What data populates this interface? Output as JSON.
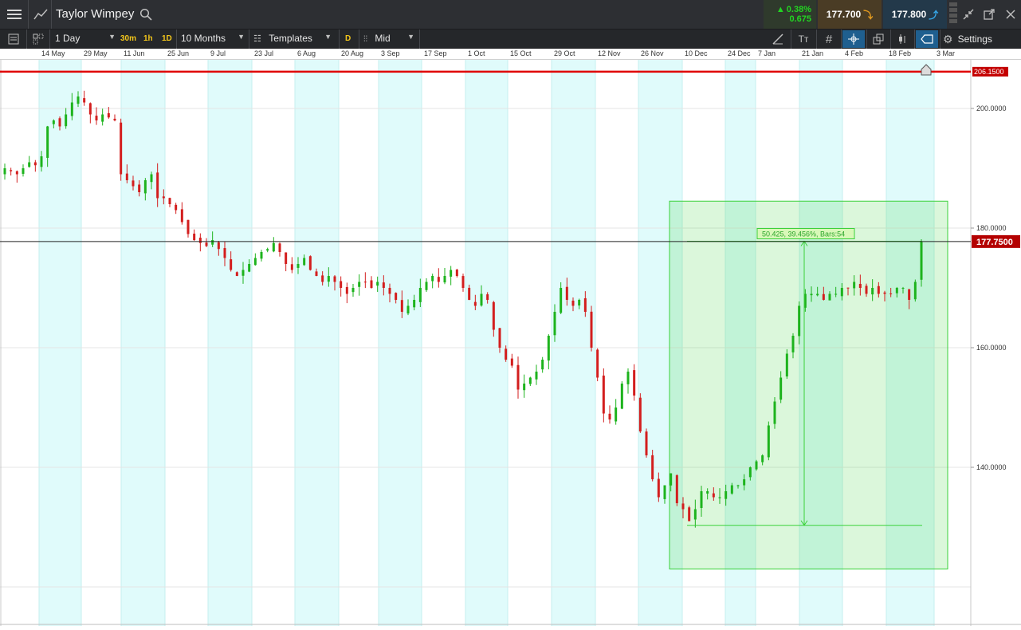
{
  "header": {
    "instrument": "Taylor Wimpey",
    "change_pct": "0.38%",
    "change_abs": "0.675",
    "sell_price": "177.700",
    "buy_price": "177.800"
  },
  "toolbar": {
    "interval": "1 Day",
    "quick_30m": "30m",
    "quick_1h": "1h",
    "quick_1d": "1D",
    "range": "10 Months",
    "templates": "Templates",
    "d_badge": "D",
    "price_type": "Mid",
    "text_tool": "Tт",
    "settings": "Settings"
  },
  "colors": {
    "up": "#1db31d",
    "down": "#d31e1e",
    "band": "#e0fbfb",
    "hline": "#e00000",
    "measure": "#3ad13a"
  },
  "chart_data": {
    "type": "candlestick",
    "date_labels": [
      "14 May",
      "29 May",
      "11 Jun",
      "25 Jun",
      "9 Jul",
      "23 Jul",
      "6 Aug",
      "20 Aug",
      "3 Sep",
      "17 Sep",
      "1 Oct",
      "15 Oct",
      "29 Oct",
      "12 Nov",
      "26 Nov",
      "10 Dec",
      "24 Dec",
      "7 Jan",
      "21 Jan",
      "4 Feb",
      "18 Feb",
      "3 Mar"
    ],
    "y_ticks": [
      "200.0000",
      "180.0000",
      "160.0000",
      "140.0000"
    ],
    "ylim": [
      117,
      216
    ],
    "horizontal_line": {
      "value": 206.15,
      "label": "206.1500"
    },
    "current_price": {
      "value": 177.75,
      "label": "177.7500"
    },
    "measurement": {
      "label": "50.425, 39.456%, Bars:54",
      "low": 130.3,
      "high": 177.8
    },
    "close_series": [
      190,
      189.5,
      189,
      190,
      191,
      190.5,
      192,
      197,
      198,
      197,
      199,
      201,
      202,
      201,
      199,
      198,
      199,
      198.5,
      198,
      189,
      188,
      187,
      186,
      188,
      189,
      185,
      185,
      184,
      183,
      181,
      179,
      178,
      177.5,
      177,
      178,
      176.5,
      175,
      173,
      172,
      173,
      174,
      175,
      176,
      176.5,
      177.5,
      176,
      174,
      173,
      174,
      175,
      173,
      172,
      171,
      172,
      171,
      170,
      169,
      170,
      171,
      171,
      170,
      171,
      170,
      169,
      168,
      166,
      167,
      168,
      170,
      171,
      172,
      171,
      172,
      173,
      172,
      170,
      168,
      167,
      169,
      168,
      163,
      160,
      158,
      157,
      153,
      154,
      155,
      156,
      158,
      162,
      166,
      170,
      168,
      167,
      168,
      166,
      160,
      155,
      149,
      148,
      150,
      154,
      156,
      152,
      146,
      142,
      138,
      135,
      137,
      139,
      134,
      133,
      131,
      133,
      136,
      136,
      135,
      135,
      136,
      137,
      137,
      138,
      140,
      141,
      142,
      147,
      151,
      155,
      159,
      162,
      167,
      169,
      169,
      169,
      168,
      169,
      169,
      170,
      170,
      171,
      170,
      169,
      170,
      169,
      169,
      169,
      170,
      170,
      168,
      171,
      177.75
    ]
  }
}
